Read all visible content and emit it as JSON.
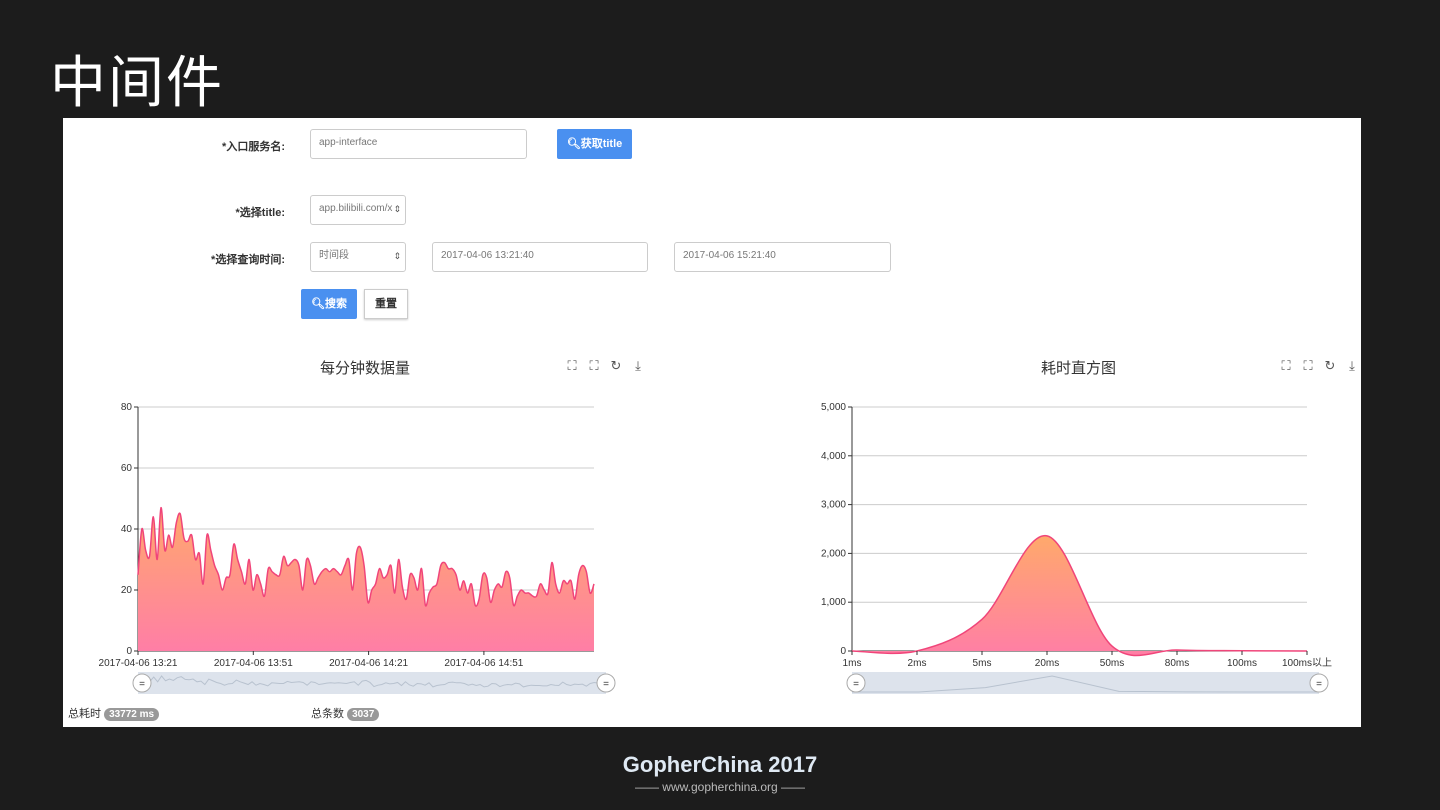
{
  "slide_title": "中间件",
  "form": {
    "service_label": "*入口服务名:",
    "service_value": "app-interface",
    "fetch_title_button": "获取title",
    "title_label": "*选择title:",
    "title_value": "app.bilibili.com/x",
    "time_label": "*选择查询时间:",
    "time_mode": "时间段",
    "start_time": "2017-04-06 13:21:40",
    "end_time": "2017-04-06 15:21:40",
    "search_button": "搜索",
    "reset_button": "重置"
  },
  "stats": {
    "total_time_label": "总耗时",
    "total_time": "33772 ms",
    "total_count_label": "总条数",
    "total_count": "3037"
  },
  "colors": {
    "accent": "#4a90f0",
    "line": "#f0457a",
    "area_top": "#ffa96b",
    "area_bottom": "#ff7ea6"
  },
  "chart_data": [
    {
      "type": "area",
      "title": "每分钟数据量",
      "ylim": [
        0,
        80
      ],
      "yticks": [
        "0",
        "20",
        "40",
        "60",
        "80"
      ],
      "xticks": [
        "2017-04-06 13:21",
        "2017-04-06 13:51",
        "2017-04-06 14:21",
        "2017-04-06 14:51"
      ],
      "x_minutes_per_tick": 30,
      "values": [
        25,
        40,
        33,
        31,
        44,
        30,
        47,
        33,
        38,
        34,
        42,
        45,
        37,
        36,
        38,
        30,
        32,
        22,
        38,
        33,
        28,
        25,
        20,
        24,
        25,
        35,
        30,
        26,
        22,
        30,
        20,
        25,
        22,
        18,
        27,
        26,
        25,
        25,
        31,
        28,
        29,
        30,
        28,
        20,
        30,
        28,
        22,
        24,
        26,
        27,
        26,
        27,
        26,
        25,
        28,
        30,
        20,
        32,
        34,
        28,
        16,
        20,
        22,
        27,
        24,
        25,
        28,
        19,
        30,
        21,
        17,
        25,
        24,
        20,
        27,
        15,
        19,
        21,
        22,
        28,
        29,
        27,
        27,
        25,
        20,
        23,
        19,
        22,
        15,
        17,
        25,
        24,
        16,
        20,
        22,
        21,
        26,
        24,
        15,
        18,
        20,
        19,
        19,
        18,
        18,
        22,
        20,
        19,
        29,
        22,
        19,
        23,
        22,
        23,
        17,
        25,
        28,
        26,
        19,
        22
      ]
    },
    {
      "type": "area",
      "title": "耗时直方图",
      "ylim": [
        0,
        5000
      ],
      "yticks": [
        "0",
        "1,000",
        "2,000",
        "3,000",
        "4,000",
        "5,000"
      ],
      "categories": [
        "1ms",
        "2ms",
        "5ms",
        "20ms",
        "50ms",
        "80ms",
        "100ms",
        "100ms以上"
      ],
      "values": [
        0,
        0,
        650,
        2360,
        100,
        20,
        5,
        0
      ]
    }
  ],
  "toolbar": {
    "icons": [
      "zoom-icon",
      "zoom-reset-icon",
      "restore-icon",
      "download-icon"
    ]
  },
  "footer": {
    "logo": "GopherChina 2017",
    "url": "www.gopherchina.org"
  }
}
